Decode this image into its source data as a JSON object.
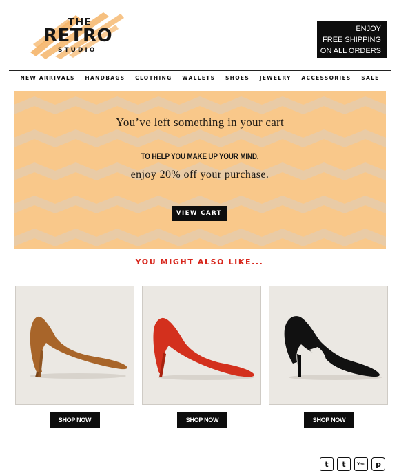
{
  "brand": {
    "logo_line1": "THE",
    "logo_line2": "RETRO",
    "logo_line3": "STUDIO",
    "accent_color": "#f5b56a"
  },
  "promo": {
    "line1": "ENJOY",
    "line2": "FREE SHIPPING",
    "line3": "ON ALL ORDERS"
  },
  "nav": {
    "items": [
      "NEW ARRIVALS",
      "HANDBAGS",
      "CLOTHING",
      "WALLETS",
      "SHOES",
      "JEWELRY",
      "ACCESSORIES",
      "SALE"
    ],
    "separator": "·"
  },
  "hero": {
    "heading": "You’ve left something in your cart",
    "subheading": "TO HELP YOU MAKE UP YOUR MIND,",
    "offer": "enjoy 20% off your purchase.",
    "button": "VIEW CART",
    "bg_color": "#f9c88a",
    "pattern_color": "#e8c9a4"
  },
  "recommendations": {
    "title": "YOU MIGHT ALSO LIKE...",
    "title_color": "#d7261c",
    "products": [
      {
        "image": "tan-suede-pump-image",
        "shoe_color": "#a8652a",
        "button": "SHOP NOW"
      },
      {
        "image": "red-suede-pump-image",
        "shoe_color": "#d3301d",
        "button": "SHOP NOW"
      },
      {
        "image": "black-cutout-pump-image",
        "shoe_color": "#111111",
        "button": "SHOP NOW"
      }
    ]
  },
  "social": {
    "icons": [
      {
        "name": "twitter-icon",
        "glyph": "t"
      },
      {
        "name": "tumblr-icon",
        "glyph": "t"
      },
      {
        "name": "youtube-icon",
        "glyph": "You"
      },
      {
        "name": "pinterest-icon",
        "glyph": "p"
      }
    ]
  }
}
